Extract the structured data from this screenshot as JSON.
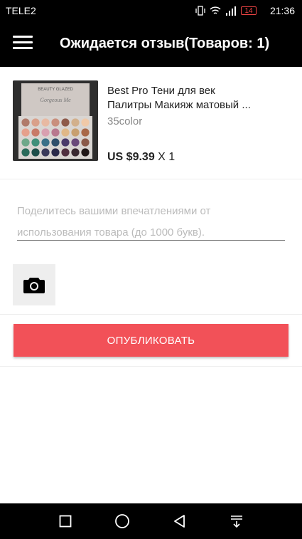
{
  "status": {
    "carrier": "TELE2",
    "battery": "14",
    "time": "21:36"
  },
  "appbar": {
    "title": "Ожидается отзыв(Товаров: 1)"
  },
  "product": {
    "name_line1": "Best Pro Тени для век",
    "name_line2": "Палитры Макияж матовый ...",
    "variant": "35color",
    "price": "US $9.39",
    "qty": "X 1",
    "image_brand": "BEAUTY GLAZED",
    "image_script": "Gorgeous Me"
  },
  "review": {
    "placeholder": "Поделитесь вашими впечатлениями от использования товара (до 1000 букв).",
    "value": ""
  },
  "publish": {
    "label": "ОПУБЛИКОВАТЬ"
  },
  "colors": {
    "accent": "#f25158",
    "bar": "#000000"
  }
}
